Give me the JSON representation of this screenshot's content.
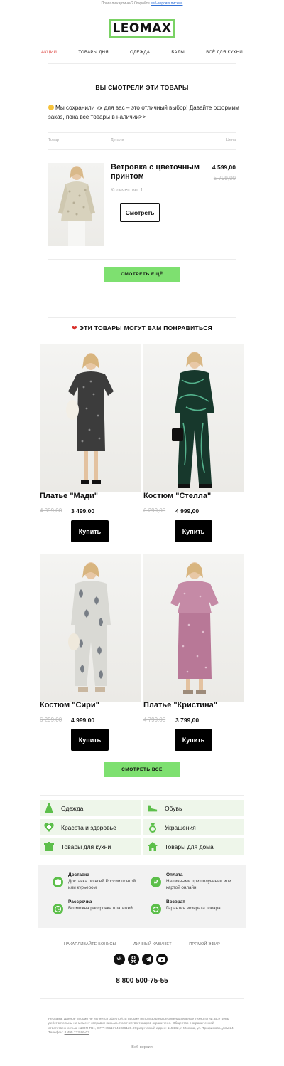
{
  "preheader": {
    "text": "Пропали картинки? Откройте",
    "link": "веб-версию письма"
  },
  "brand": {
    "logo_text": "LEOMAX",
    "accent": "#7ad264"
  },
  "nav": [
    {
      "label": "АКЦИИ",
      "color": "#d9302b"
    },
    {
      "label": "ТОВАРЫ ДНЯ"
    },
    {
      "label": "ОДЕЖДА"
    },
    {
      "label": "БАДЫ"
    },
    {
      "label": "ВСЁ ДЛЯ КУХНИ"
    }
  ],
  "viewed": {
    "title": "ВЫ СМОТРЕЛИ ЭТИ ТОВАРЫ",
    "intro": "Мы сохранили их для вас – это отличный выбор! Давайте оформим заказ, пока все товары в наличии>>",
    "headers": {
      "product": "Товар",
      "details": "Детали",
      "price": "Цена"
    },
    "item": {
      "name": "Ветровка с цветочным принтом",
      "price": "4 599,00",
      "old_price": "5 799,00",
      "quantity": "Количество: 1",
      "button": "Смотреть"
    },
    "more_button": "СМОТРЕТЬ ЕЩЁ"
  },
  "recommend": {
    "title": "ЭТИ ТОВАРЫ МОГУТ ВАМ ПОНРАВИТЬСЯ",
    "products": [
      {
        "name": "Платье \"Мади\"",
        "old_price": "4 399,00",
        "price": "3 499,00",
        "button": "Купить"
      },
      {
        "name": "Костюм \"Стелла\"",
        "old_price": "6 299,00",
        "price": "4 999,00",
        "button": "Купить"
      },
      {
        "name": "Костюм \"Сири\"",
        "old_price": "6 299,00",
        "price": "4 999,00",
        "button": "Купить"
      },
      {
        "name": "Платье \"Кристина\"",
        "old_price": "4 799,00",
        "price": "3 799,00",
        "button": "Купить"
      }
    ],
    "all_button": "СМОТРЕТЬ ВСЕ"
  },
  "categories": [
    {
      "label": "Одежда",
      "icon": "dress-icon"
    },
    {
      "label": "Обувь",
      "icon": "shoe-icon"
    },
    {
      "label": "Красота и здоровье",
      "icon": "heart-plus-icon"
    },
    {
      "label": "Украшения",
      "icon": "ring-icon"
    },
    {
      "label": "Товары для кухни",
      "icon": "pot-icon"
    },
    {
      "label": "Товары для дома",
      "icon": "house-icon"
    }
  ],
  "benefits": [
    {
      "title": "Доставка",
      "text": "Доставка по всей России почтой или курьером",
      "icon": "box-icon"
    },
    {
      "title": "Оплата",
      "text": "Наличными при получении или картой онлайн",
      "icon": "ruble-icon"
    },
    {
      "title": "Рассрочка",
      "text": "Возможна рассрочка платежей",
      "icon": "clock-icon"
    },
    {
      "title": "Возврат",
      "text": "Гарантия возврата товара",
      "icon": "return-icon"
    }
  ],
  "footer": {
    "links": [
      "НАКАПЛИВАЙТЕ БОНУСЫ",
      "ЛИЧНЫЙ КАБИНЕТ",
      "ПРЯМОЙ ЭФИР"
    ],
    "social": [
      "vk-icon",
      "ok-icon",
      "telegram-icon",
      "youtube-icon"
    ],
    "phone": "8 800 500-75-55",
    "legal": "Реклама. Данное письмо не является офертой. В письме использованы рекомендательные технологии. Все цены действительны на момент отправки письма. Количество товаров ограничено. Общество с ограниченной ответственностью «ШОП ТВ», ОГРН 5117746036128. Юридический адрес: 115432, г. Москва, ул. Трофимова, дом 24. Телефон:",
    "legal_phone": "8 495 733-96-03",
    "web_version": "Веб-версия"
  },
  "colors": {
    "green_button": "#7ee070",
    "category_bg": "#eef6ea",
    "icon_green": "#5cbf4a",
    "red": "#d9302b"
  }
}
